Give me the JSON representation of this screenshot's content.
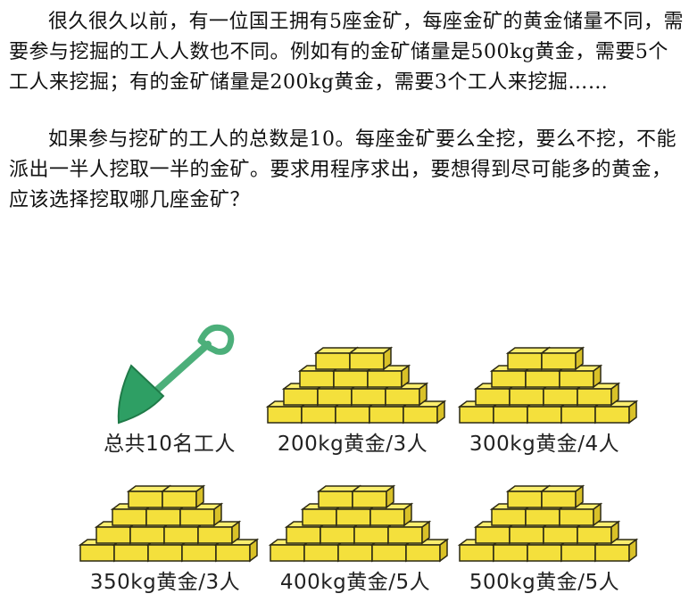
{
  "paragraphs": [
    "很久很久以前，有一位国王拥有5座金矿，每座金矿的黄金储量不同，需要参与挖掘的工人人数也不同。例如有的金矿储量是500kg黄金，需要5个工人来挖掘；有的金矿储量是200kg黄金，需要3个工人来挖掘……",
    "如果参与挖矿的工人的总数是10。每座金矿要么全挖，要么不挖，不能派出一半人挖取一半的金矿。要求用程序求出，要想得到尽可能多的黄金，应该选择挖取哪几座金矿？"
  ],
  "figure": {
    "shovel": {
      "icon": "shovel-icon",
      "caption": "总共10名工人",
      "color": "#4CAF7A"
    },
    "mines": [
      {
        "caption": "200kg黄金/3人"
      },
      {
        "caption": "300kg黄金/4人"
      },
      {
        "caption": "350kg黄金/3人"
      },
      {
        "caption": "400kg黄金/5人"
      },
      {
        "caption": "500kg黄金/5人"
      }
    ],
    "gold_color": "#F4E03C"
  }
}
